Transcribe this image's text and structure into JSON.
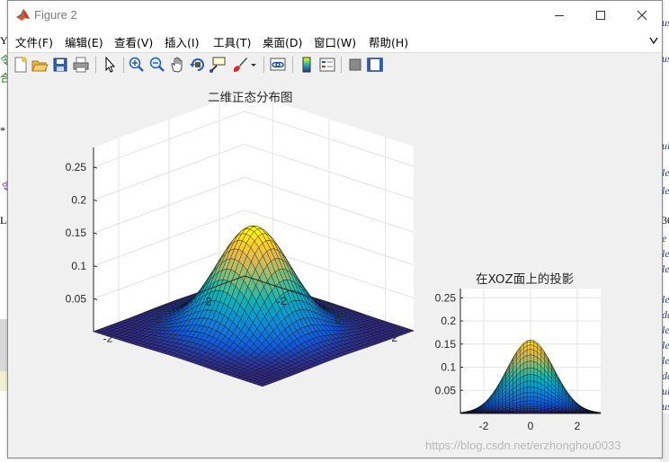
{
  "window": {
    "title": "Figure 2",
    "controls": [
      "minimize",
      "maximize",
      "close"
    ]
  },
  "menubar": {
    "items": [
      "文件(F)",
      "编辑(E)",
      "查看(V)",
      "插入(I)",
      "工具(T)",
      "桌面(D)",
      "窗口(W)",
      "帮助(H)"
    ]
  },
  "toolbar": {
    "buttons": [
      "new-figure-icon",
      "open-file-icon",
      "save-icon",
      "print-icon",
      "pointer-icon",
      "zoom-in-icon",
      "zoom-out-icon",
      "pan-hand-icon",
      "rotate-3d-icon",
      "data-cursor-icon",
      "brush-icon",
      "brush-dropdown-icon",
      "link-plot-icon",
      "colorbar-icon",
      "legend-icon",
      "hide-plot-tools-icon",
      "show-plot-tools-icon"
    ]
  },
  "chart_data": [
    {
      "type": "surface",
      "title": "二维正态分布图",
      "function": "z = exp(-(x^2+y^2)/2) / (2*pi)",
      "x_range": [
        -3,
        3
      ],
      "y_range": [
        -3,
        3
      ],
      "z_range": [
        0,
        0.28
      ],
      "x_ticks": [
        "-2",
        "0",
        "2"
      ],
      "y_ticks": [
        "2",
        "0",
        "-2"
      ],
      "z_ticks": [
        "0.05",
        "0.1",
        "0.15",
        "0.2",
        "0.25"
      ],
      "peak_z": 0.159,
      "colormap": "parula",
      "grid": true
    },
    {
      "type": "surface-projection",
      "title": "在XOZ面上的投影",
      "view": "XOZ",
      "x_ticks": [
        "-2",
        "0",
        "2"
      ],
      "z_ticks": [
        "0.05",
        "0.1",
        "0.15",
        "0.2",
        "0.25"
      ],
      "x_range": [
        -3,
        3
      ],
      "z_range": [
        0,
        0.27
      ],
      "colormap": "parula",
      "grid": true
    }
  ],
  "watermark": "https://blog.csdn.net/erzhonghou0033",
  "background_editor": {
    "left_fragments": [
      "Y",
      "令",
      "合",
      "*",
      "令",
      "Le"
    ],
    "right_fragments": [
      "us",
      "us",
      "ule",
      "le",
      "le",
      "30",
      "e",
      "le",
      "le",
      "le",
      "da",
      "le",
      "le",
      "le",
      "da",
      "ule",
      "us"
    ]
  }
}
